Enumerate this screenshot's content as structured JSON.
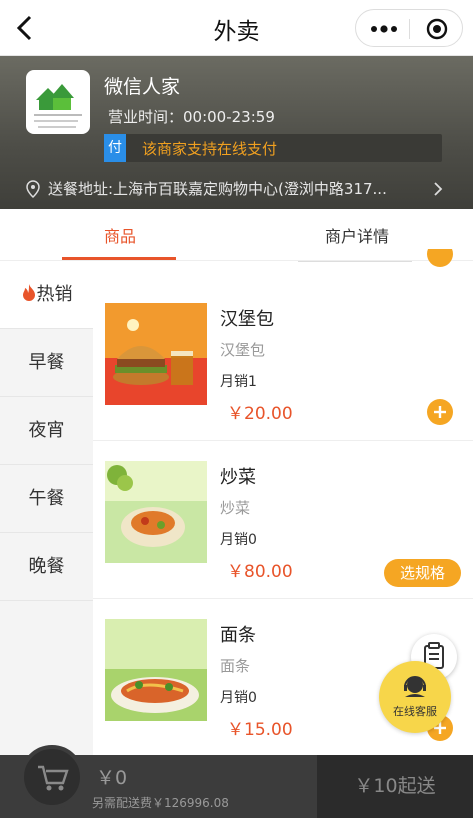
{
  "header": {
    "title": "外卖"
  },
  "shop": {
    "name": "微信人家",
    "hours": "营业时间：00:00-23:59",
    "pay_badge": "付",
    "pay_text": "该商家支持在线支付",
    "address": "送餐地址:上海市百联嘉定购物中心(澄浏中路317..."
  },
  "tabs": [
    {
      "label": "商品"
    },
    {
      "label": "商户详情"
    }
  ],
  "sidebar": {
    "items": [
      {
        "label": "热销"
      },
      {
        "label": "早餐"
      },
      {
        "label": "夜宵"
      },
      {
        "label": "午餐"
      },
      {
        "label": "晚餐"
      }
    ]
  },
  "products": [
    {
      "name": "汉堡包",
      "desc": "汉堡包",
      "sales": "月销1",
      "price": "￥20.00"
    },
    {
      "name": "炒菜",
      "desc": "炒菜",
      "sales": "月销0",
      "price": "￥80.00",
      "spec_label": "选规格"
    },
    {
      "name": "面条",
      "desc": "面条",
      "sales": "月销0",
      "price": "￥15.00"
    }
  ],
  "float": {
    "service_label": "在线客服"
  },
  "cart": {
    "total": "￥0",
    "fee": "另需配送费￥126996.08",
    "min_order": "￥10起送"
  },
  "colors": {
    "accent": "#e8542a",
    "button": "#f5a623",
    "pay_badge": "#2a8ee8"
  }
}
